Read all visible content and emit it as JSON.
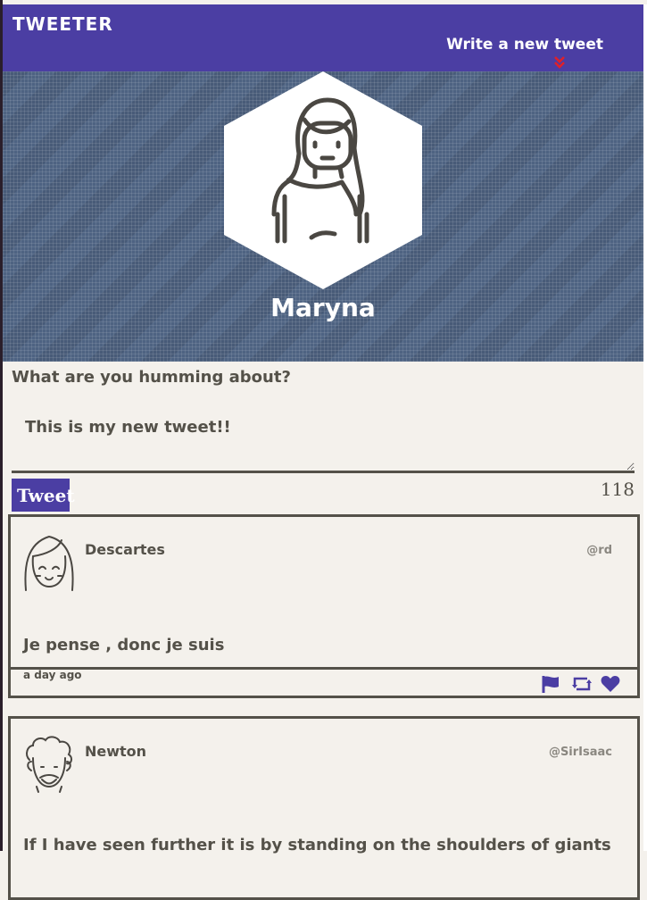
{
  "navbar": {
    "brand": "TWEETER",
    "compose_label": "Write a new tweet",
    "compose_icon": "double-chevron-down-icon",
    "accent": "#4b3ea3",
    "arrow_color": "#e0202a"
  },
  "profile": {
    "name": "Maryna",
    "avatar_icon": "woman-avatar-icon"
  },
  "composer": {
    "label": "What are you humming about?",
    "text": "This is my new tweet!!",
    "button": "Tweet",
    "counter": "118"
  },
  "tweets": [
    {
      "name": "Descartes",
      "handle": "@rd",
      "text": "Je pense , donc je suis",
      "time": "a day ago",
      "avatar_icon": "girl-avatar-icon"
    },
    {
      "name": "Newton",
      "handle": "@SirIsaac",
      "text": "If I have seen further it is by standing on the shoulders of giants",
      "avatar_icon": "curly-hair-avatar-icon"
    }
  ]
}
